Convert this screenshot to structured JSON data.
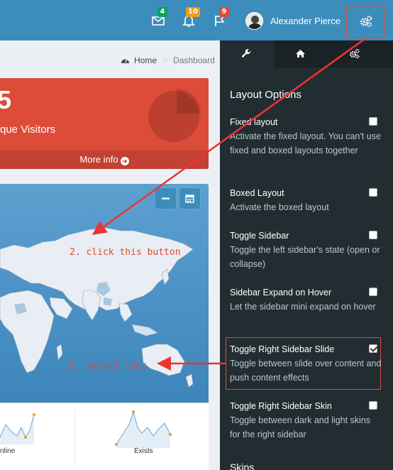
{
  "navbar": {
    "mail_count": "4",
    "notification_count": "10",
    "flag_count": "9",
    "user_name": "Alexander Pierce"
  },
  "breadcrumb": {
    "home": "Home",
    "current": "Dashboard"
  },
  "small_box": {
    "number": "5",
    "label": "que Visitors",
    "footer": "More info",
    "color": "#dd4b39"
  },
  "sparklines": {
    "left_caption": "nline",
    "right_caption": "Exists"
  },
  "control_sidebar": {
    "tabs": [
      "wrench-icon",
      "home-icon",
      "gears-icon"
    ],
    "title": "Layout Options",
    "options": [
      {
        "label": "Fixed layout",
        "desc": "Activate the fixed layout. You can't use fixed and boxed layouts together",
        "checked": false
      },
      {
        "label": "Boxed Layout",
        "desc": "Activate the boxed layout",
        "checked": false
      },
      {
        "label": "Toggle Sidebar",
        "desc": "Toggle the left sidebar's state (open or collapse)",
        "checked": false
      },
      {
        "label": "Sidebar Expand on Hover",
        "desc": "Let the sidebar mini expand on hover",
        "checked": false
      },
      {
        "label": "Toggle Right Sidebar Slide",
        "desc": "Toggle between slide over content and push content effects",
        "checked": true
      },
      {
        "label": "Toggle Right Sidebar Skin",
        "desc": "Toggle between dark and light skins for the right sidebar",
        "checked": false
      }
    ],
    "skins_heading": "Skins"
  },
  "annotations": {
    "step1": "1. select this",
    "step2": "2. click this button"
  },
  "colors": {
    "navbar": "#3c8dbc",
    "sidebar": "#222d32",
    "annotation": "#dd4b39"
  }
}
